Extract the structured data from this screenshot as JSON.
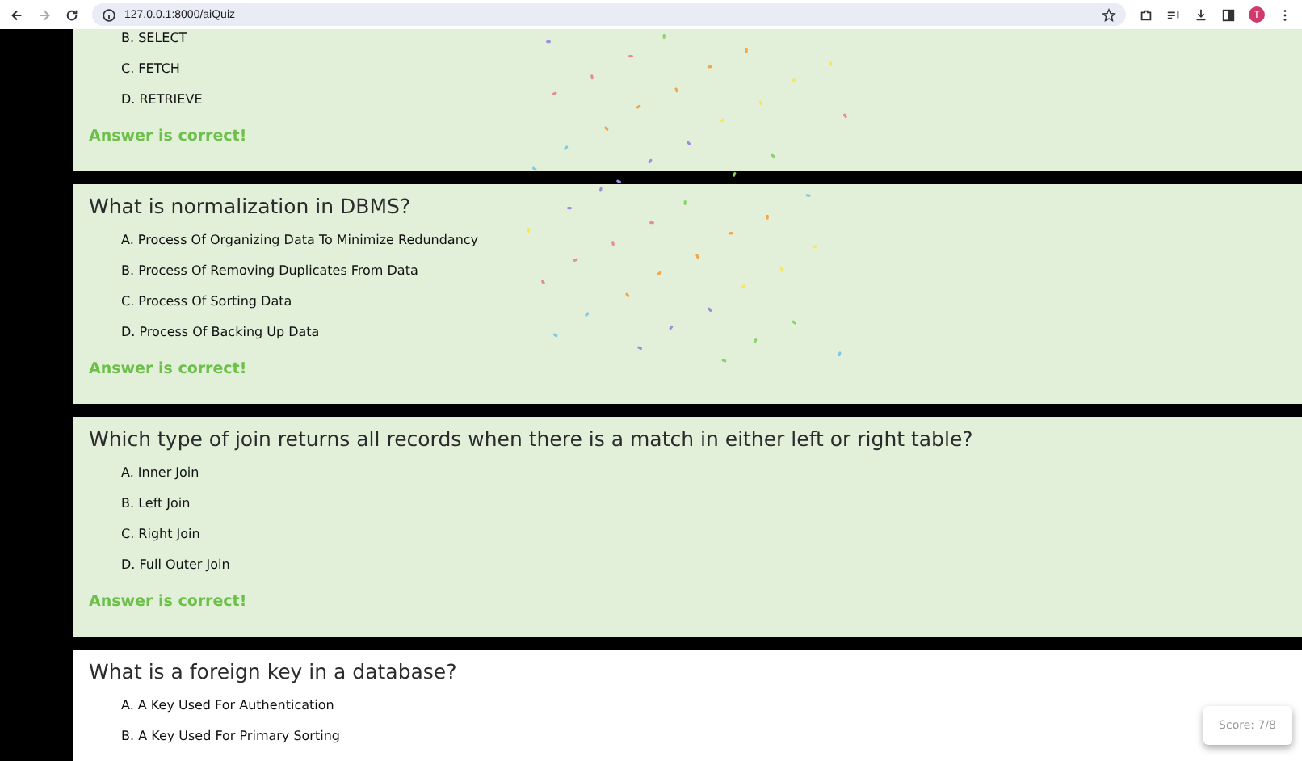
{
  "browser": {
    "url": "127.0.0.1:8000/aiQuiz",
    "avatar": "T"
  },
  "questions": [
    {
      "answered": true,
      "options": [
        "B. SELECT",
        "C. FETCH",
        "D. RETRIEVE"
      ],
      "result": "Answer is correct!"
    },
    {
      "question": "What is normalization in DBMS?",
      "answered": true,
      "options": [
        "A. Process Of Organizing Data To Minimize Redundancy",
        "B. Process Of Removing Duplicates From Data",
        "C. Process Of Sorting Data",
        "D. Process Of Backing Up Data"
      ],
      "result": "Answer is correct!"
    },
    {
      "question": "Which type of join returns all records when there is a match in either left or right table?",
      "answered": true,
      "options": [
        "A. Inner Join",
        "B. Left Join",
        "C. Right Join",
        "D. Full Outer Join"
      ],
      "result": "Answer is correct!"
    },
    {
      "question": "What is a foreign key in a database?",
      "answered": false,
      "options": [
        "A. A Key Used For Authentication",
        "B. A Key Used For Primary Sorting"
      ]
    }
  ],
  "score": "Score: 7/8"
}
